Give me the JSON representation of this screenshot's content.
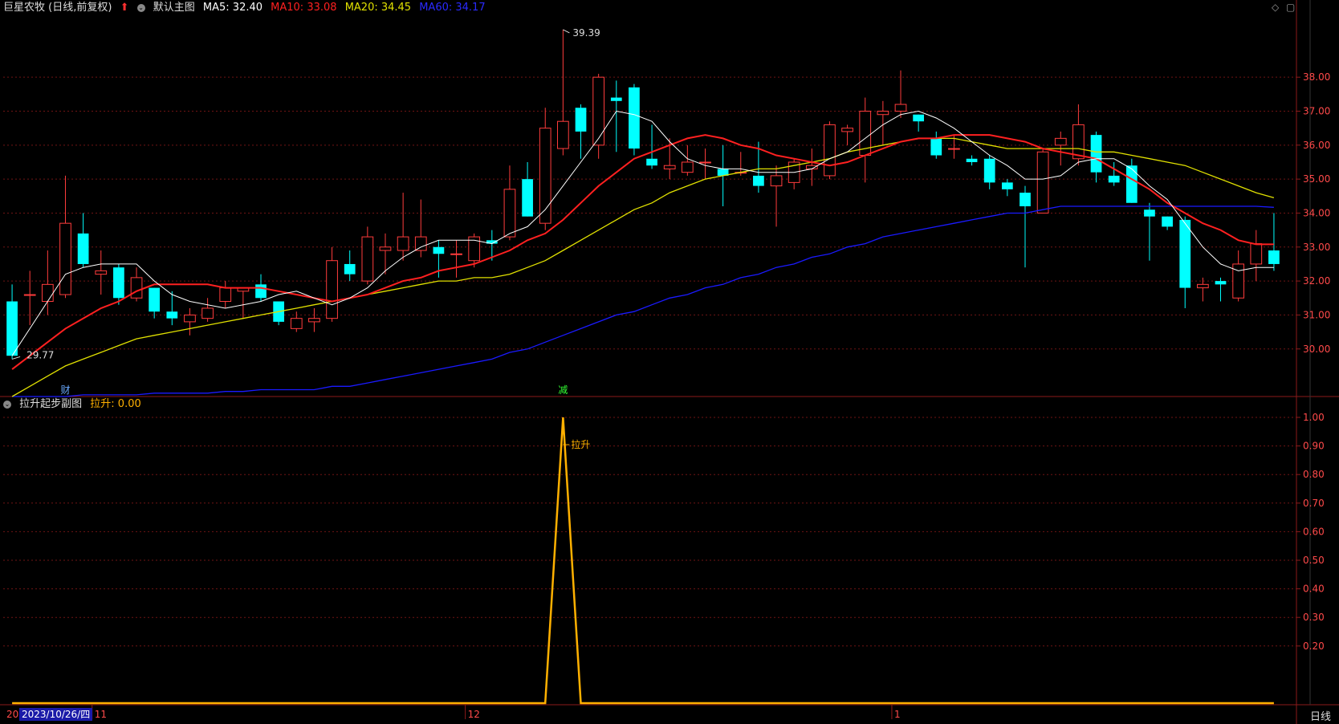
{
  "header": {
    "stock": "巨星农牧 (日线,前复权)",
    "main_chart_label": "默认主图",
    "ma5": "MA5: 32.40",
    "ma10": "MA10: 33.08",
    "ma20": "MA20: 34.45",
    "ma60": "MA60: 34.17"
  },
  "sub_header": {
    "title": "拉升起步副图",
    "value": "拉升: 0.00"
  },
  "footer": {
    "date": "2023/10/26/四",
    "left_stub": "20",
    "month_11": "11",
    "month_12": "12",
    "month_1": "1",
    "period": "日线"
  },
  "markers": {
    "cai": "财",
    "jian": "减",
    "high_label": "39.39",
    "low_label": "29.77",
    "lashen_label": "拉升"
  },
  "colors": {
    "up": "#ff3c3c",
    "down": "#00ffff",
    "ma5": "#ffffff",
    "ma10": "#ff2020",
    "ma20": "#e0e000",
    "ma60": "#1a1aff",
    "sub_line": "#ffb000",
    "axis": "#8b1a1a"
  },
  "chart_data": [
    {
      "type": "candlestick",
      "title": "巨星农牧 (日线,前复权)",
      "y_ticks": [
        30.0,
        31.0,
        32.0,
        33.0,
        34.0,
        35.0,
        36.0,
        37.0,
        38.0
      ],
      "ylim": [
        28.6,
        39.8
      ],
      "grid": true,
      "candles": [
        [
          31.4,
          29.8,
          31.9,
          29.7
        ],
        [
          31.6,
          31.6,
          32.3,
          30.7
        ],
        [
          31.4,
          31.9,
          32.9,
          31.0
        ],
        [
          31.6,
          33.7,
          35.1,
          31.5
        ],
        [
          33.4,
          32.5,
          34.0,
          32.4
        ],
        [
          32.2,
          32.3,
          32.9,
          31.6
        ],
        [
          32.4,
          31.5,
          32.5,
          31.3
        ],
        [
          31.5,
          32.1,
          32.4,
          31.4
        ],
        [
          31.8,
          31.1,
          31.8,
          30.9
        ],
        [
          31.1,
          30.9,
          31.7,
          30.7
        ],
        [
          30.8,
          31.0,
          31.2,
          30.4
        ],
        [
          30.9,
          31.2,
          31.5,
          30.8
        ],
        [
          31.4,
          31.8,
          32.0,
          31.2
        ],
        [
          31.7,
          31.8,
          31.8,
          30.9
        ],
        [
          31.9,
          31.5,
          32.2,
          31.4
        ],
        [
          31.4,
          30.8,
          31.4,
          30.7
        ],
        [
          30.6,
          30.9,
          31.1,
          30.5
        ],
        [
          30.8,
          30.9,
          31.2,
          30.5
        ],
        [
          30.9,
          32.6,
          33.0,
          30.8
        ],
        [
          32.5,
          32.2,
          32.9,
          32.0
        ],
        [
          32.0,
          33.3,
          33.6,
          31.9
        ],
        [
          32.9,
          33.0,
          33.4,
          32.2
        ],
        [
          32.9,
          33.3,
          34.6,
          32.6
        ],
        [
          32.9,
          33.3,
          34.4,
          32.7
        ],
        [
          33.0,
          32.8,
          33.2,
          32.1
        ],
        [
          32.8,
          32.8,
          33.2,
          32.1
        ],
        [
          32.6,
          33.3,
          33.4,
          32.4
        ],
        [
          33.2,
          33.1,
          33.5,
          32.6
        ],
        [
          33.3,
          34.7,
          35.4,
          33.2
        ],
        [
          35.0,
          33.9,
          35.5,
          33.9
        ],
        [
          33.7,
          36.5,
          37.1,
          33.5
        ],
        [
          35.9,
          36.7,
          39.4,
          35.7
        ],
        [
          37.1,
          36.4,
          37.2,
          35.6
        ],
        [
          36.0,
          38.0,
          38.1,
          35.6
        ],
        [
          37.4,
          37.3,
          37.9,
          35.8
        ],
        [
          37.7,
          35.9,
          37.8,
          35.7
        ],
        [
          35.6,
          35.4,
          36.6,
          35.3
        ],
        [
          35.3,
          35.4,
          36.2,
          35.0
        ],
        [
          35.2,
          35.5,
          36.0,
          35.1
        ],
        [
          35.5,
          35.5,
          35.9,
          35.0
        ],
        [
          35.3,
          35.1,
          36.0,
          34.2
        ],
        [
          35.2,
          35.2,
          35.8,
          35.1
        ],
        [
          35.1,
          34.8,
          36.1,
          34.6
        ],
        [
          34.8,
          35.1,
          35.4,
          33.6
        ],
        [
          34.9,
          35.5,
          35.6,
          34.7
        ],
        [
          35.3,
          35.4,
          35.9,
          34.8
        ],
        [
          35.1,
          36.6,
          36.7,
          35.0
        ],
        [
          36.4,
          36.5,
          36.6,
          36.0
        ],
        [
          35.7,
          37.0,
          37.4,
          34.9
        ],
        [
          36.9,
          37.0,
          37.3,
          36.0
        ],
        [
          37.0,
          37.2,
          38.2,
          36.8
        ],
        [
          36.9,
          36.7,
          36.9,
          36.4
        ],
        [
          36.2,
          35.7,
          36.4,
          35.6
        ],
        [
          35.9,
          35.9,
          36.3,
          35.6
        ],
        [
          35.6,
          35.5,
          35.7,
          35.4
        ],
        [
          35.6,
          34.9,
          35.7,
          34.7
        ],
        [
          34.9,
          34.7,
          35.0,
          34.5
        ],
        [
          34.6,
          34.2,
          34.8,
          32.4
        ],
        [
          34.0,
          35.8,
          35.9,
          34.0
        ],
        [
          36.0,
          36.2,
          36.4,
          35.4
        ],
        [
          35.6,
          36.6,
          37.2,
          35.4
        ],
        [
          36.3,
          35.2,
          36.4,
          34.9
        ],
        [
          35.1,
          34.9,
          35.5,
          34.8
        ],
        [
          35.4,
          34.3,
          35.6,
          34.3
        ],
        [
          34.1,
          33.9,
          34.3,
          32.6
        ],
        [
          33.9,
          33.6,
          33.9,
          33.5
        ],
        [
          33.8,
          31.8,
          33.9,
          31.2
        ],
        [
          31.8,
          31.9,
          32.1,
          31.4
        ],
        [
          32.0,
          31.9,
          32.1,
          31.4
        ],
        [
          31.5,
          32.5,
          32.9,
          31.4
        ],
        [
          32.5,
          33.1,
          33.5,
          32.0
        ],
        [
          32.9,
          32.5,
          34.0,
          32.3
        ]
      ],
      "ma5": [
        29.8,
        30.6,
        31.4,
        32.2,
        32.4,
        32.5,
        32.5,
        32.5,
        32.0,
        31.6,
        31.4,
        31.3,
        31.2,
        31.3,
        31.4,
        31.6,
        31.7,
        31.5,
        31.3,
        31.5,
        31.8,
        32.3,
        32.7,
        33.0,
        33.2,
        33.2,
        33.2,
        33.1,
        33.4,
        33.6,
        34.1,
        34.8,
        35.5,
        36.2,
        37.0,
        36.9,
        36.7,
        36.1,
        35.6,
        35.4,
        35.3,
        35.3,
        35.2,
        35.2,
        35.2,
        35.3,
        35.6,
        35.8,
        36.2,
        36.6,
        36.9,
        37.0,
        36.8,
        36.5,
        36.1,
        35.7,
        35.4,
        35.0,
        35.0,
        35.1,
        35.5,
        35.6,
        35.6,
        35.3,
        34.8,
        34.4,
        33.7,
        33.0,
        32.5,
        32.3,
        32.4,
        32.4
      ],
      "ma10": [
        29.4,
        29.8,
        30.2,
        30.6,
        30.9,
        31.2,
        31.4,
        31.7,
        31.9,
        31.9,
        31.9,
        31.9,
        31.8,
        31.8,
        31.8,
        31.7,
        31.6,
        31.5,
        31.4,
        31.5,
        31.6,
        31.8,
        32.0,
        32.1,
        32.3,
        32.4,
        32.5,
        32.7,
        32.9,
        33.2,
        33.4,
        33.8,
        34.3,
        34.8,
        35.2,
        35.6,
        35.8,
        36.0,
        36.2,
        36.3,
        36.2,
        36.0,
        35.9,
        35.7,
        35.6,
        35.5,
        35.4,
        35.5,
        35.7,
        35.9,
        36.1,
        36.2,
        36.2,
        36.3,
        36.3,
        36.3,
        36.2,
        36.1,
        35.9,
        35.8,
        35.7,
        35.6,
        35.3,
        35.0,
        34.7,
        34.3,
        34.0,
        33.7,
        33.5,
        33.2,
        33.08,
        33.08
      ],
      "ma20": [
        28.6,
        28.9,
        29.2,
        29.5,
        29.7,
        29.9,
        30.1,
        30.3,
        30.4,
        30.5,
        30.6,
        30.7,
        30.8,
        30.9,
        31.0,
        31.1,
        31.2,
        31.3,
        31.4,
        31.5,
        31.6,
        31.7,
        31.8,
        31.9,
        32.0,
        32.0,
        32.1,
        32.1,
        32.2,
        32.4,
        32.6,
        32.9,
        33.2,
        33.5,
        33.8,
        34.1,
        34.3,
        34.6,
        34.8,
        35.0,
        35.1,
        35.2,
        35.3,
        35.3,
        35.4,
        35.5,
        35.6,
        35.8,
        35.9,
        36.0,
        36.1,
        36.2,
        36.2,
        36.2,
        36.1,
        36.0,
        35.9,
        35.9,
        35.9,
        35.9,
        35.9,
        35.8,
        35.8,
        35.7,
        35.6,
        35.5,
        35.4,
        35.2,
        35.0,
        34.8,
        34.6,
        34.45
      ],
      "ma60": [
        28.6,
        28.6,
        28.6,
        28.6,
        28.65,
        28.65,
        28.65,
        28.65,
        28.7,
        28.7,
        28.7,
        28.7,
        28.75,
        28.75,
        28.8,
        28.8,
        28.8,
        28.8,
        28.9,
        28.9,
        29.0,
        29.1,
        29.2,
        29.3,
        29.4,
        29.5,
        29.6,
        29.7,
        29.9,
        30.0,
        30.2,
        30.4,
        30.6,
        30.8,
        31.0,
        31.1,
        31.3,
        31.5,
        31.6,
        31.8,
        31.9,
        32.1,
        32.2,
        32.4,
        32.5,
        32.7,
        32.8,
        33.0,
        33.1,
        33.3,
        33.4,
        33.5,
        33.6,
        33.7,
        33.8,
        33.9,
        34.0,
        34.0,
        34.1,
        34.2,
        34.2,
        34.2,
        34.2,
        34.2,
        34.2,
        34.2,
        34.2,
        34.2,
        34.2,
        34.2,
        34.2,
        34.17
      ]
    },
    {
      "type": "line",
      "title": "拉升起步副图",
      "y_ticks": [
        0.2,
        0.3,
        0.4,
        0.5,
        0.6,
        0.7,
        0.8,
        0.9,
        1.0
      ],
      "ylim": [
        0,
        1.0
      ],
      "grid": true,
      "series": [
        {
          "name": "拉升",
          "spike_index": 31,
          "spike_value": 1.0,
          "base_value": 0.0
        }
      ]
    }
  ]
}
